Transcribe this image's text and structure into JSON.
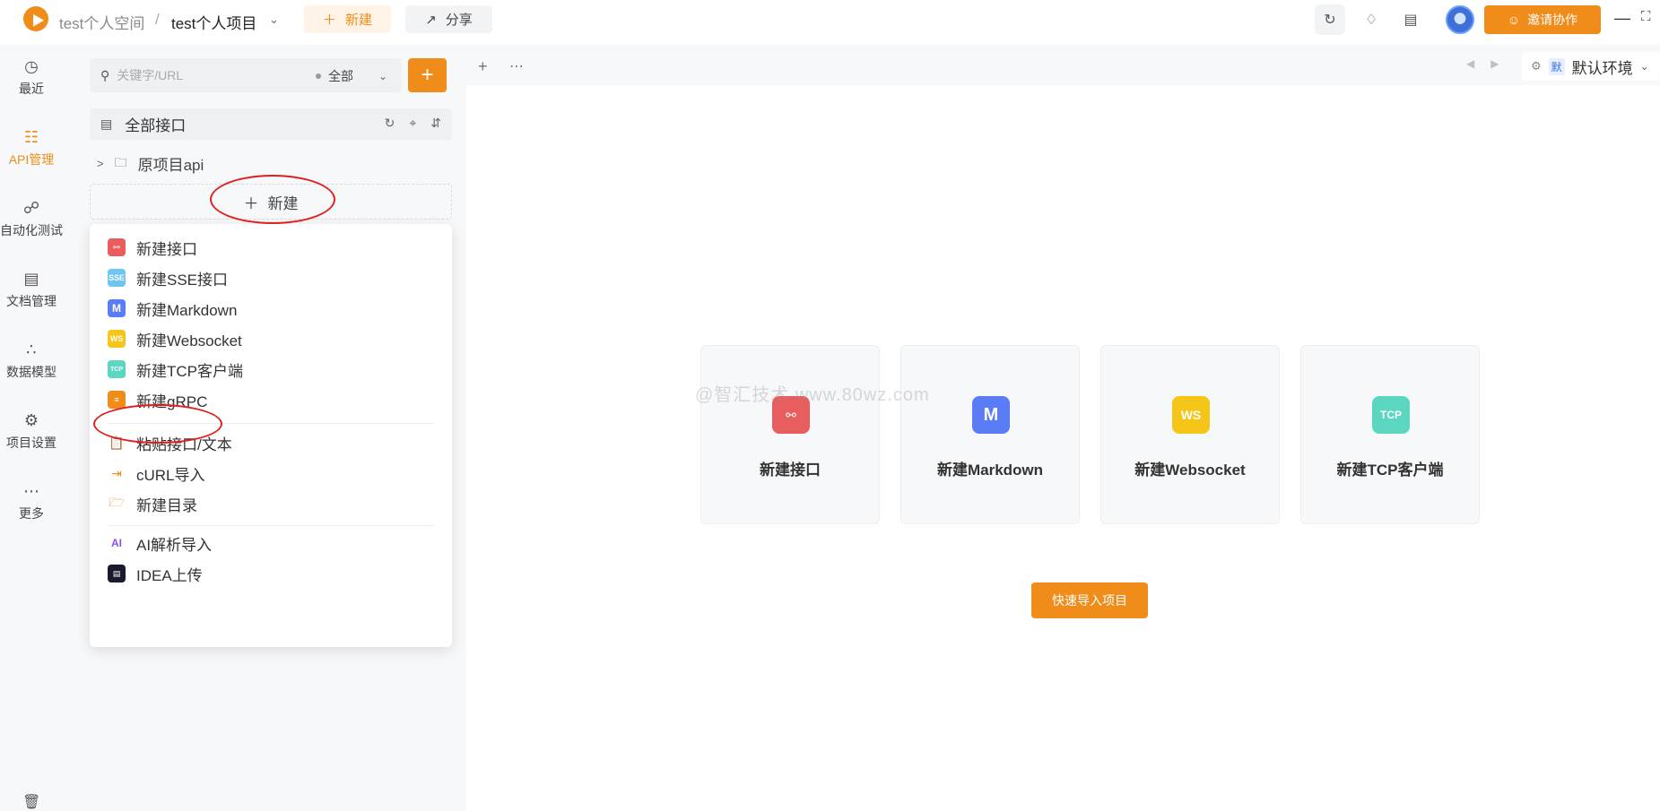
{
  "header": {
    "space": "test个人空间",
    "separator": "/",
    "project": "test个人项目",
    "new_label": "新建",
    "share_label": "分享",
    "invite_label": "邀请协作"
  },
  "rail": {
    "items": [
      {
        "label": "最近",
        "icon": "clock-icon"
      },
      {
        "label": "API管理",
        "icon": "api-icon"
      },
      {
        "label": "自动化测试",
        "icon": "automation-icon"
      },
      {
        "label": "文档管理",
        "icon": "document-icon"
      },
      {
        "label": "数据模型",
        "icon": "data-model-icon"
      },
      {
        "label": "项目设置",
        "icon": "settings-icon"
      },
      {
        "label": "更多",
        "icon": "more-icon"
      }
    ]
  },
  "panel": {
    "search_placeholder": "关键字/URL",
    "filter_label": "全部",
    "tree_root": "全部接口",
    "folder": "原项目api",
    "new_label": "新建"
  },
  "menu": {
    "items": [
      {
        "label": "新建接口",
        "icon": "api-icon"
      },
      {
        "label": "新建SSE接口",
        "icon": "sse-icon"
      },
      {
        "label": "新建Markdown",
        "icon": "markdown-icon"
      },
      {
        "label": "新建Websocket",
        "icon": "websocket-icon"
      },
      {
        "label": "新建TCP客户端",
        "icon": "tcp-icon"
      },
      {
        "label": "新建gRPC",
        "icon": "grpc-icon"
      },
      {
        "label": "粘贴接口/文本",
        "icon": "paste-icon"
      },
      {
        "label": "cURL导入",
        "icon": "curl-import-icon"
      },
      {
        "label": "新建目录",
        "icon": "new-folder-icon"
      },
      {
        "label": "AI解析导入",
        "icon": "ai-icon"
      },
      {
        "label": "IDEA上传",
        "icon": "idea-icon"
      }
    ]
  },
  "env": {
    "badge": "默",
    "name": "默认环境"
  },
  "main": {
    "cards": [
      {
        "label": "新建接口",
        "icon": "api-icon"
      },
      {
        "label": "新建Markdown",
        "icon": "markdown-icon"
      },
      {
        "label": "新建Websocket",
        "icon": "websocket-icon"
      },
      {
        "label": "新建TCP客户端",
        "icon": "tcp-icon"
      }
    ],
    "import_label": "快速导入项目",
    "watermark": "@智汇技术 www.80wz.com"
  },
  "icon_text": {
    "sse": "SSE",
    "markdown": "M",
    "websocket": "WS",
    "tcp": "TCP",
    "ai": "AI"
  },
  "colors": {
    "accent": "#f08c1a",
    "api": "#e85d5d",
    "sse": "#6ec6f0",
    "markdown": "#5b7cf7",
    "websocket": "#f5c518",
    "tcp": "#5bd6c0",
    "highlight": "#e02020"
  }
}
